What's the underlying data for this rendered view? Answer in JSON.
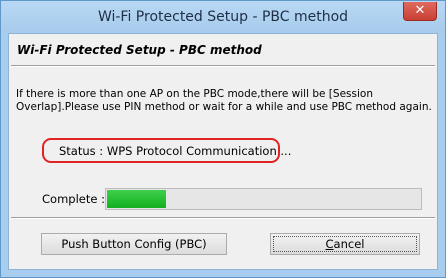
{
  "window": {
    "title": "Wi-Fi Protected Setup - PBC method",
    "close_glyph": "✕"
  },
  "dialog": {
    "heading": "Wi-Fi Protected Setup - PBC method",
    "description_line1": "If there is more than one AP on the PBC mode,there will be [Session",
    "description_line2": "Overlap].Please use PIN method or wait for a while and use PBC method again.",
    "status_text": "Status : WPS Protocol Communication ...",
    "complete_label": "Complete :",
    "progress_fraction": 0.19
  },
  "buttons": {
    "pbc_label": "Push Button Config (PBC)",
    "cancel_first": "C",
    "cancel_rest": "ancel"
  },
  "colors": {
    "progress": "#1aaf28",
    "highlight": "#e02424"
  }
}
